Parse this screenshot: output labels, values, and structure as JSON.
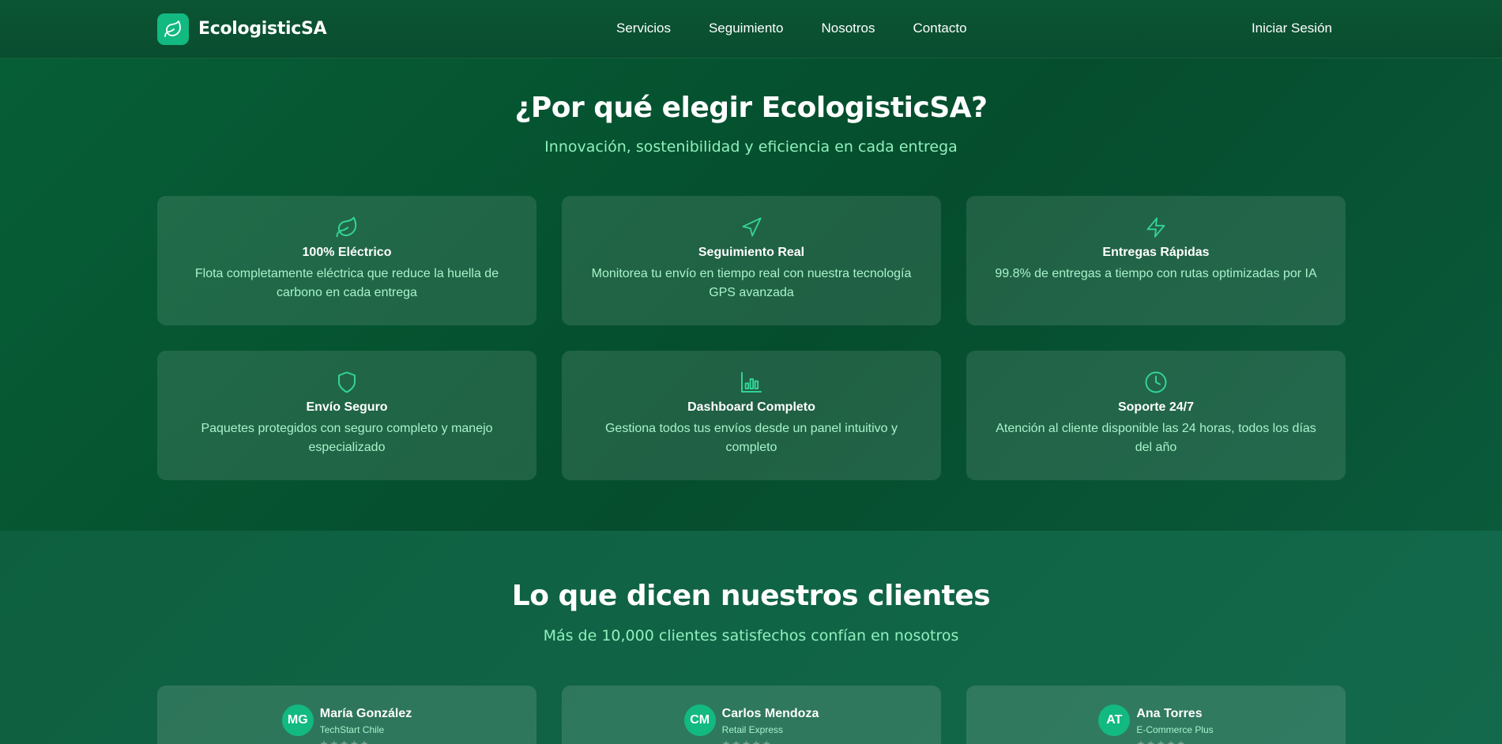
{
  "header": {
    "brand": "EcologisticSA",
    "nav": [
      "Servicios",
      "Seguimiento",
      "Nosotros",
      "Contacto"
    ],
    "login": "Iniciar Sesión",
    "accent_color": "#12b981"
  },
  "features": {
    "title": "¿Por qué elegir EcologisticSA?",
    "subtitle": "Innovación, sostenibilidad y eficiencia en cada entrega",
    "cards": [
      {
        "icon": "leaf-icon",
        "title": "100% Eléctrico",
        "desc": "Flota completamente eléctrica que reduce la huella de carbono en cada entrega"
      },
      {
        "icon": "navigation-icon",
        "title": "Seguimiento Real",
        "desc": "Monitorea tu envío en tiempo real con nuestra tecnología GPS avanzada"
      },
      {
        "icon": "lightning-icon",
        "title": "Entregas Rápidas",
        "desc": "99.8% de entregas a tiempo con rutas optimizadas por IA"
      },
      {
        "icon": "shield-icon",
        "title": "Envío Seguro",
        "desc": "Paquetes protegidos con seguro completo y manejo especializado"
      },
      {
        "icon": "bar-chart-icon",
        "title": "Dashboard Completo",
        "desc": "Gestiona todos tus envíos desde un panel intuitivo y completo"
      },
      {
        "icon": "clock-icon",
        "title": "Soporte 24/7",
        "desc": "Atención al cliente disponible las 24 horas, todos los días del año"
      }
    ]
  },
  "testimonials": {
    "title": "Lo que dicen nuestros clientes",
    "subtitle": "Más de 10,000 clientes satisfechos confían en nosotros",
    "items": [
      {
        "initials": "MG",
        "name": "María González",
        "company": "TechStart Chile",
        "stars": "★★★★★"
      },
      {
        "initials": "CM",
        "name": "Carlos Mendoza",
        "company": "Retail Express",
        "stars": "★★★★★"
      },
      {
        "initials": "AT",
        "name": "Ana Torres",
        "company": "E-Commerce Plus",
        "stars": "★★★★★"
      }
    ]
  }
}
